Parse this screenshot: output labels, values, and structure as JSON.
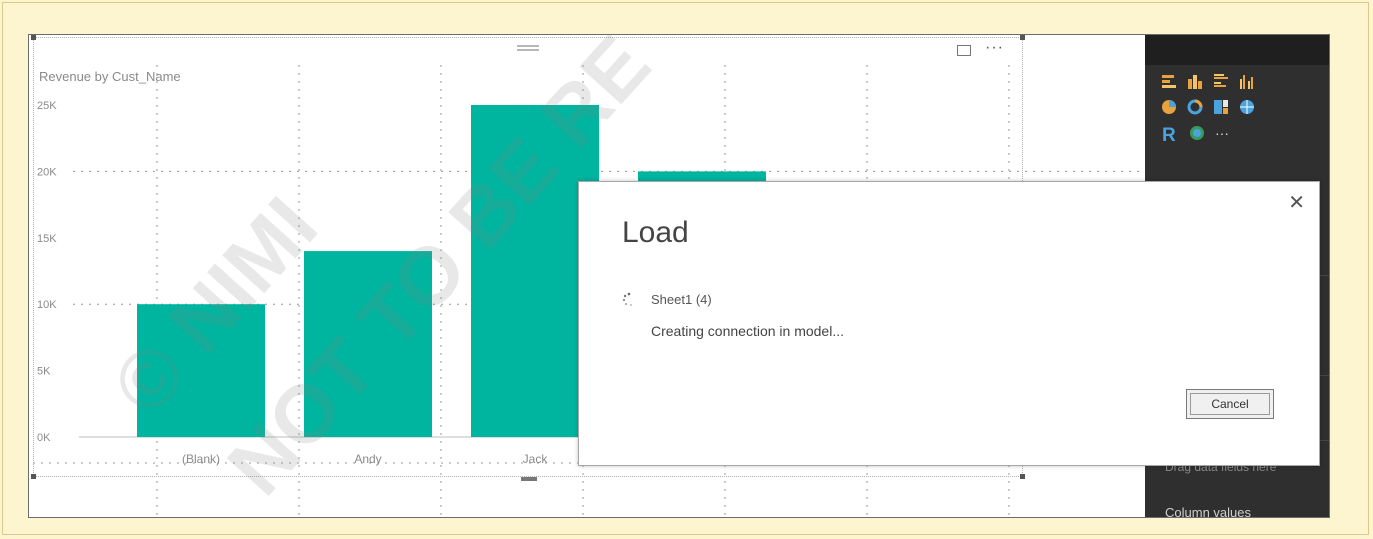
{
  "chart": {
    "title": "Revenue by Cust_Name",
    "more_label": "···"
  },
  "chart_data": {
    "type": "bar",
    "title": "Revenue by Cust_Name",
    "categories": [
      "(Blank)",
      "Andy",
      "Jack",
      ""
    ],
    "values": [
      10000,
      14000,
      25000,
      20000
    ],
    "ylim": [
      0,
      25000
    ],
    "yticks": [
      "0K",
      "5K",
      "10K",
      "15K",
      "20K",
      "25K"
    ],
    "bar_color": "#00b5a0",
    "grid": true
  },
  "panel": {
    "r_label": "R",
    "more_label": "···",
    "field_hint": "Drag data fields here",
    "column_values_label": "Column values"
  },
  "dialog": {
    "title": "Load",
    "close_glyph": "✕",
    "item_name": "Sheet1 (4)",
    "item_status": "Creating connection in model...",
    "cancel_label": "Cancel"
  },
  "watermark": {
    "line1": "© NIMI",
    "line2": "NOT TO BE RE"
  },
  "colors": {
    "accent": "#00b5a0",
    "panel_bg": "#2f2f2f",
    "page_bg": "#fdf5d0"
  }
}
